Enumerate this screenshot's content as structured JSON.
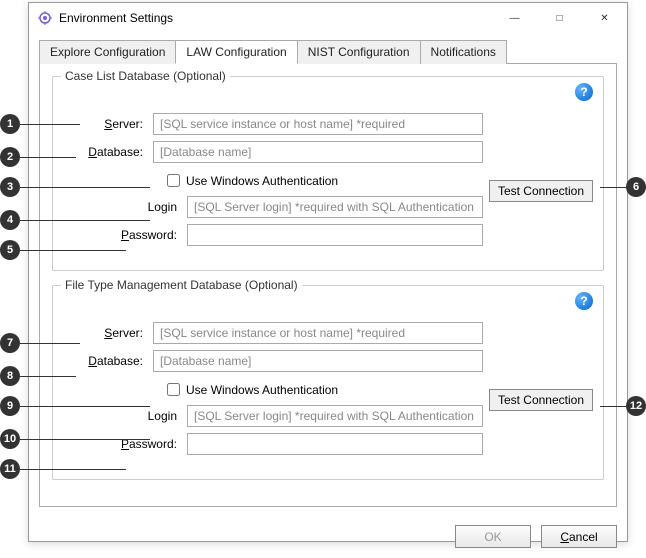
{
  "window": {
    "title": "Environment Settings"
  },
  "tabs": [
    {
      "label": "Explore Configuration"
    },
    {
      "label": "LAW Configuration"
    },
    {
      "label": "NIST Configuration"
    },
    {
      "label": "Notifications"
    }
  ],
  "group1": {
    "title": "Case List Database (Optional)",
    "server_label": "Server:",
    "server_placeholder": "[SQL service instance or host name] *required",
    "database_label": "Database:",
    "database_placeholder": "[Database name]",
    "winauth_label": "Use Windows Authentication",
    "login_label": "Login",
    "login_placeholder": "[SQL Server login] *required with SQL Authentication",
    "password_label": "Password:",
    "test_label": "Test Connection"
  },
  "group2": {
    "title": "File Type Management Database (Optional)",
    "server_label": "Server:",
    "server_placeholder": "[SQL service instance or host name] *required",
    "database_label": "Database:",
    "database_placeholder": "[Database name]",
    "winauth_label": "Use Windows Authentication",
    "login_label": "Login",
    "login_placeholder": "[SQL Server login] *required with SQL Authentication",
    "password_label": "Password:",
    "test_label": "Test Connection"
  },
  "buttons": {
    "ok": "OK",
    "cancel": "Cancel"
  },
  "callouts": [
    "1",
    "2",
    "3",
    "4",
    "5",
    "6",
    "7",
    "8",
    "9",
    "10",
    "11",
    "12"
  ]
}
